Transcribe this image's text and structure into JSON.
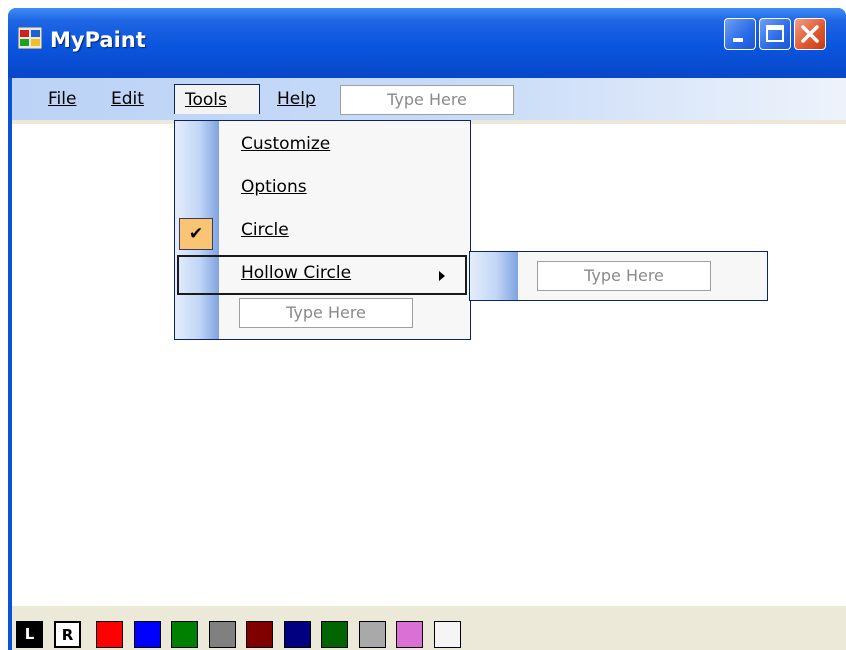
{
  "window": {
    "title": "MyPaint"
  },
  "menubar": {
    "items": [
      {
        "label": "File"
      },
      {
        "label": "Edit"
      },
      {
        "label": "Tools"
      },
      {
        "label": "Help"
      }
    ],
    "type_here": "Type Here"
  },
  "tools_menu": {
    "items": [
      {
        "label": "Customize"
      },
      {
        "label": "Options"
      },
      {
        "label": "Circle",
        "checked": true
      },
      {
        "label": "Hollow Circle",
        "has_submenu": true,
        "highlighted": true
      }
    ],
    "type_here": "Type Here"
  },
  "submenu": {
    "type_here": "Type Here"
  },
  "palette": {
    "left_label": "L",
    "right_label": "R",
    "colors": [
      "#ff0000",
      "#0000ff",
      "#008000",
      "#808080",
      "#800000",
      "#000080",
      "#006400",
      "#a9a9a9",
      "#da70d6",
      "#f5f5f5"
    ]
  },
  "colors": {
    "titlebar": "#0a55de",
    "menubar": "#c8dbf8",
    "menu_check": "#f9c574"
  }
}
